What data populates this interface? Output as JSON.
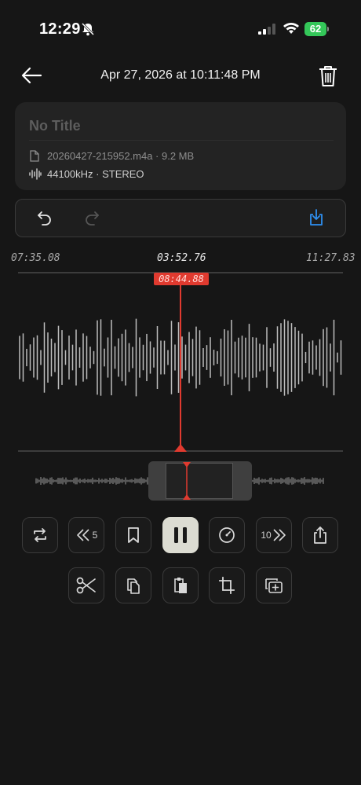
{
  "status_bar": {
    "time": "12:29",
    "battery": "62"
  },
  "header": {
    "title": "Apr 27, 2026 at 10:11:48 PM"
  },
  "info": {
    "title_placeholder": "No Title",
    "file_text": "20260427-215952.m4a · 9.2 MB",
    "audio_text": "44100kHz · STEREO"
  },
  "timeline": {
    "start": "07:35.08",
    "center": "03:52.76",
    "end": "11:27.83",
    "playhead": "08:44.88"
  },
  "controls": {
    "skip_back_label": "5",
    "skip_forward_label": "10"
  },
  "colors": {
    "accent": "#e03a2f",
    "save_blue": "#2f8ff0",
    "battery": "#34c759"
  },
  "icons": [
    "back-arrow-icon",
    "trash-icon",
    "file-icon",
    "waveform-icon",
    "undo-icon",
    "redo-icon",
    "save-icon",
    "loop-icon",
    "rewind-icon",
    "bookmark-icon",
    "pause-icon",
    "speed-icon",
    "forward-icon",
    "share-icon",
    "scissors-icon",
    "copy-icon",
    "paste-icon",
    "crop-icon",
    "insert-icon"
  ]
}
